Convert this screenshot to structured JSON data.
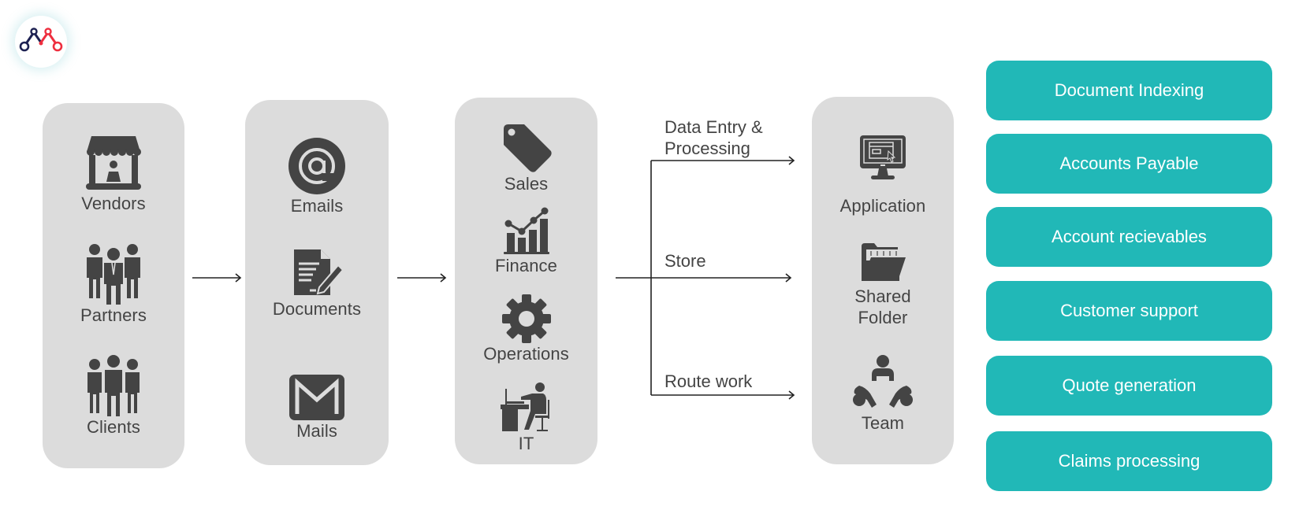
{
  "logo": {
    "icon": "brand-logo-icon",
    "colors": {
      "left": "#1d2152",
      "right": "#ee2f3f"
    }
  },
  "columns": {
    "sources": [
      {
        "label": "Vendors",
        "icon": "storefront-icon"
      },
      {
        "label": "Partners",
        "icon": "business-people-icon"
      },
      {
        "label": "Clients",
        "icon": "people-group-icon"
      }
    ],
    "channels": [
      {
        "label": "Emails",
        "icon": "at-sign-icon"
      },
      {
        "label": "Documents",
        "icon": "document-edit-icon"
      },
      {
        "label": "Mails",
        "icon": "gmail-icon"
      }
    ],
    "departments": [
      {
        "label": "Sales",
        "icon": "price-tag-icon"
      },
      {
        "label": "Finance",
        "icon": "bar-chart-growth-icon"
      },
      {
        "label": "Operations",
        "icon": "gear-icon"
      },
      {
        "label": "IT",
        "icon": "person-at-desk-icon"
      }
    ],
    "destinations": [
      {
        "label": "Application",
        "icon": "monitor-app-icon"
      },
      {
        "label": "Shared Folder",
        "line1": "Shared",
        "line2": "Folder",
        "icon": "folder-open-icon"
      },
      {
        "label": "Team",
        "icon": "team-meeting-icon"
      }
    ]
  },
  "flows": [
    {
      "label_line1": "Data Entry &",
      "label_line2": "Processing"
    },
    {
      "label": "Store"
    },
    {
      "label": "Route work"
    }
  ],
  "services": [
    "Document Indexing",
    "Accounts Payable",
    "Account recievables",
    "Customer support",
    "Quote generation",
    "Claims processing"
  ],
  "colors": {
    "panel": "#dcdcdc",
    "icon": "#444444",
    "accent": "#21b8b7",
    "arrow": "#222222"
  }
}
